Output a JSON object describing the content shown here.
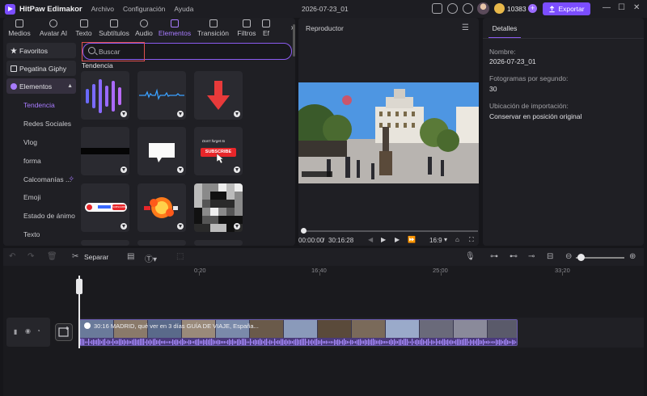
{
  "app": {
    "name": "HitPaw Edimakor",
    "menu": [
      "Archivo",
      "Configuración",
      "Ayuda"
    ],
    "project_title": "2026-07-23_01",
    "coins": "10383",
    "plus_label": "+",
    "export_label": "Exportar"
  },
  "tabs": [
    {
      "label": "Medios",
      "icon": "folder-icon"
    },
    {
      "label": "Avatar AI",
      "icon": "avatar-icon"
    },
    {
      "label": "Texto",
      "icon": "text-icon"
    },
    {
      "label": "Subtítulos",
      "icon": "subtitles-icon"
    },
    {
      "label": "Audio",
      "icon": "music-icon"
    },
    {
      "label": "Elementos",
      "icon": "elements-icon",
      "active": true
    },
    {
      "label": "Transición",
      "icon": "transition-icon"
    },
    {
      "label": "Filtros",
      "icon": "filter-icon"
    },
    {
      "label": "Ef",
      "icon": "effects-icon"
    }
  ],
  "sidebar": {
    "top_items": [
      {
        "label": "Favoritos",
        "icon": "star-icon"
      },
      {
        "label": "Pegatina Giphy",
        "icon": "giphy-icon"
      },
      {
        "label": "Elementos",
        "icon": "elements-icon",
        "active": true
      }
    ],
    "sub_items": [
      {
        "label": "Tendencia",
        "active": true
      },
      {
        "label": "Redes Sociales"
      },
      {
        "label": "Vlog"
      },
      {
        "label": "forma"
      },
      {
        "label": "Calcomanías ...",
        "badge": true
      },
      {
        "label": "Emoji"
      },
      {
        "label": "Estado de ánimo"
      },
      {
        "label": "Texto"
      }
    ]
  },
  "search": {
    "placeholder": "Buscar"
  },
  "section_title": "Tendencia",
  "elements": [
    {
      "name": "waveform-bars"
    },
    {
      "name": "audio-wave-line"
    },
    {
      "name": "red-arrow-down"
    },
    {
      "name": "black-bar"
    },
    {
      "name": "speech-bubble"
    },
    {
      "name": "subscribe-sticker",
      "text_top": "Don't forget to",
      "text_btn": "SUBSCRIBE"
    },
    {
      "name": "subscribe-bar",
      "text": "SUBSCRIBE"
    },
    {
      "name": "explosion-subscribe"
    },
    {
      "name": "mosaic-pixel"
    }
  ],
  "player": {
    "title": "Reproductor",
    "current_time": "00:00:00",
    "separator": "/",
    "total_time": "30:16:28",
    "aspect_ratio": "16:9",
    "progress": 0.0
  },
  "details": {
    "tab": "Detalles",
    "fields": [
      {
        "label": "Nombre:",
        "value": "2026-07-23_01"
      },
      {
        "label": "Fotogramas por segundo:",
        "value": "30"
      },
      {
        "label": "Ubicación de importación:",
        "value": "Conservar en posición original"
      }
    ]
  },
  "toolbar": {
    "split_label": "Separar"
  },
  "timeline": {
    "ruler": [
      "0:20",
      "16:40",
      "25:00",
      "33:20"
    ],
    "clip_title": "30:16 MADRID, qué ver en 3 días GUÍA DE VIAJE, España..."
  }
}
